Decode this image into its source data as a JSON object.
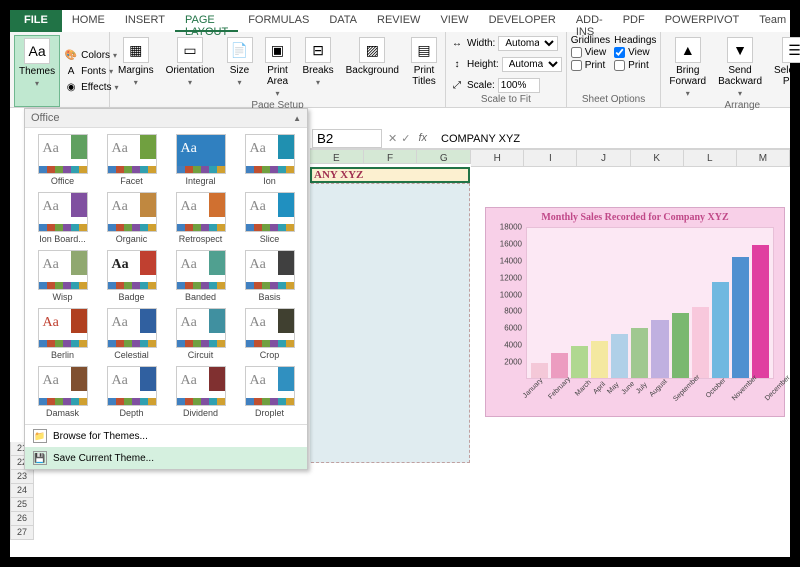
{
  "tabs": {
    "file": "FILE",
    "items": [
      "HOME",
      "INSERT",
      "PAGE LAYOUT",
      "FORMULAS",
      "DATA",
      "REVIEW",
      "VIEW",
      "DEVELOPER",
      "ADD-INS",
      "PDF",
      "POWERPIVOT",
      "Team"
    ],
    "active": "PAGE LAYOUT"
  },
  "ribbon": {
    "themes": {
      "btn": "Themes",
      "colors": "Colors",
      "fonts": "Fonts",
      "effects": "Effects"
    },
    "pagesetup": {
      "label": "Page Setup",
      "margins": "Margins",
      "orientation": "Orientation",
      "size": "Size",
      "printarea": "Print\nArea",
      "breaks": "Breaks",
      "background": "Background",
      "printtitles": "Print\nTitles"
    },
    "scale": {
      "label": "Scale to Fit",
      "width": "Width:",
      "height": "Height:",
      "scale": "Scale:",
      "auto": "Automatic",
      "pct": "100%"
    },
    "sheet": {
      "label": "Sheet Options",
      "gridlines": "Gridlines",
      "headings": "Headings",
      "view": "View",
      "print": "Print"
    },
    "arrange": {
      "label": "Arrange",
      "forward": "Bring\nForward",
      "backward": "Send\nBackward",
      "selpane": "Selection\nPane"
    }
  },
  "themes_panel": {
    "header": "Office",
    "items": [
      {
        "name": "Office",
        "c": "#60a060",
        "aa": "#888"
      },
      {
        "name": "Facet",
        "c": "#70a040",
        "aa": "#888"
      },
      {
        "name": "Integral",
        "c": "#3080c0",
        "aa": "#fff",
        "bg": "#3080c0"
      },
      {
        "name": "Ion",
        "c": "#2090b0",
        "aa": "#888"
      },
      {
        "name": "Ion Board...",
        "c": "#8050a0",
        "aa": "#888"
      },
      {
        "name": "Organic",
        "c": "#c08840",
        "aa": "#888"
      },
      {
        "name": "Retrospect",
        "c": "#d07030",
        "aa": "#888"
      },
      {
        "name": "Slice",
        "c": "#2090c0",
        "aa": "#888"
      },
      {
        "name": "Wisp",
        "c": "#90a870",
        "aa": "#888"
      },
      {
        "name": "Badge",
        "c": "#c04030",
        "aa": "#222",
        "bold": true
      },
      {
        "name": "Banded",
        "c": "#50a090",
        "aa": "#888"
      },
      {
        "name": "Basis",
        "c": "#404040",
        "aa": "#888"
      },
      {
        "name": "Berlin",
        "c": "#b04020",
        "aa": "#c04030"
      },
      {
        "name": "Celestial",
        "c": "#3060a0",
        "aa": "#888"
      },
      {
        "name": "Circuit",
        "c": "#4090a0",
        "aa": "#888"
      },
      {
        "name": "Crop",
        "c": "#404030",
        "aa": "#888"
      },
      {
        "name": "Damask",
        "c": "#805030",
        "aa": "#888"
      },
      {
        "name": "Depth",
        "c": "#3060a0",
        "aa": "#888"
      },
      {
        "name": "Dividend",
        "c": "#803030",
        "aa": "#888"
      },
      {
        "name": "Droplet",
        "c": "#3090c0",
        "aa": "#888"
      }
    ],
    "browse": "Browse for Themes...",
    "save": "Save Current Theme..."
  },
  "formula_bar": {
    "cell_ref": "B2",
    "content": "COMPANY XYZ"
  },
  "columns": [
    "E",
    "F",
    "G",
    "H",
    "I",
    "J",
    "K",
    "L",
    "M"
  ],
  "selected_cols": [
    "E",
    "F",
    "G"
  ],
  "row_numbers": [
    "21",
    "22",
    "23",
    "24",
    "25",
    "26",
    "27"
  ],
  "sheet": {
    "title": "ANY XYZ"
  },
  "chart_data": {
    "type": "bar",
    "title": "Monthly Sales Recorded for Company XYZ",
    "categories": [
      "January",
      "February",
      "March",
      "April",
      "May",
      "June",
      "July",
      "August",
      "September",
      "October",
      "November",
      "December"
    ],
    "values": [
      1800,
      3000,
      3800,
      4500,
      5300,
      6000,
      7000,
      7800,
      8500,
      11500,
      14500,
      16000
    ],
    "colors": [
      "#f4c8d8",
      "#ec9cc0",
      "#b0d890",
      "#f4e8a0",
      "#b0d0e8",
      "#a0c890",
      "#c0b0e0",
      "#7ab870",
      "#f8c8dc",
      "#70b8e0",
      "#5090d0",
      "#e040a0"
    ],
    "ylim": [
      0,
      18000
    ],
    "yticks": [
      18000,
      16000,
      14000,
      12000,
      10000,
      8000,
      6000,
      4000,
      2000
    ]
  }
}
